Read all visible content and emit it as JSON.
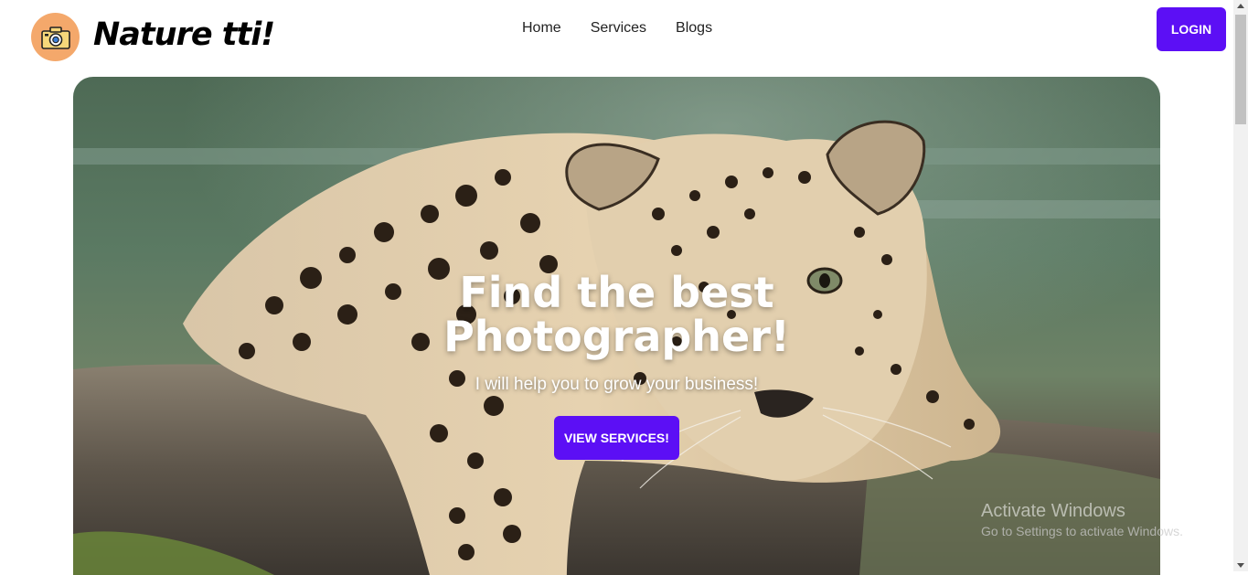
{
  "brand": {
    "name": "Nature tti!",
    "logo_icon": "camera-icon",
    "logo_color": "#f4a86b"
  },
  "nav": {
    "items": [
      {
        "label": "Home"
      },
      {
        "label": "Services"
      },
      {
        "label": "Blogs"
      }
    ]
  },
  "header": {
    "login_label": "LOGIN",
    "accent": "#5c0ff5"
  },
  "hero": {
    "title_line1": "Find the best",
    "title_line2": "Photographer!",
    "subtitle": "I will help you to grow your business!",
    "cta_label": "VIEW SERVICES!",
    "image_subject": "leopard-resting-on-log"
  },
  "watermark": {
    "line1": "Activate Windows",
    "line2": "Go to Settings to activate Windows."
  }
}
